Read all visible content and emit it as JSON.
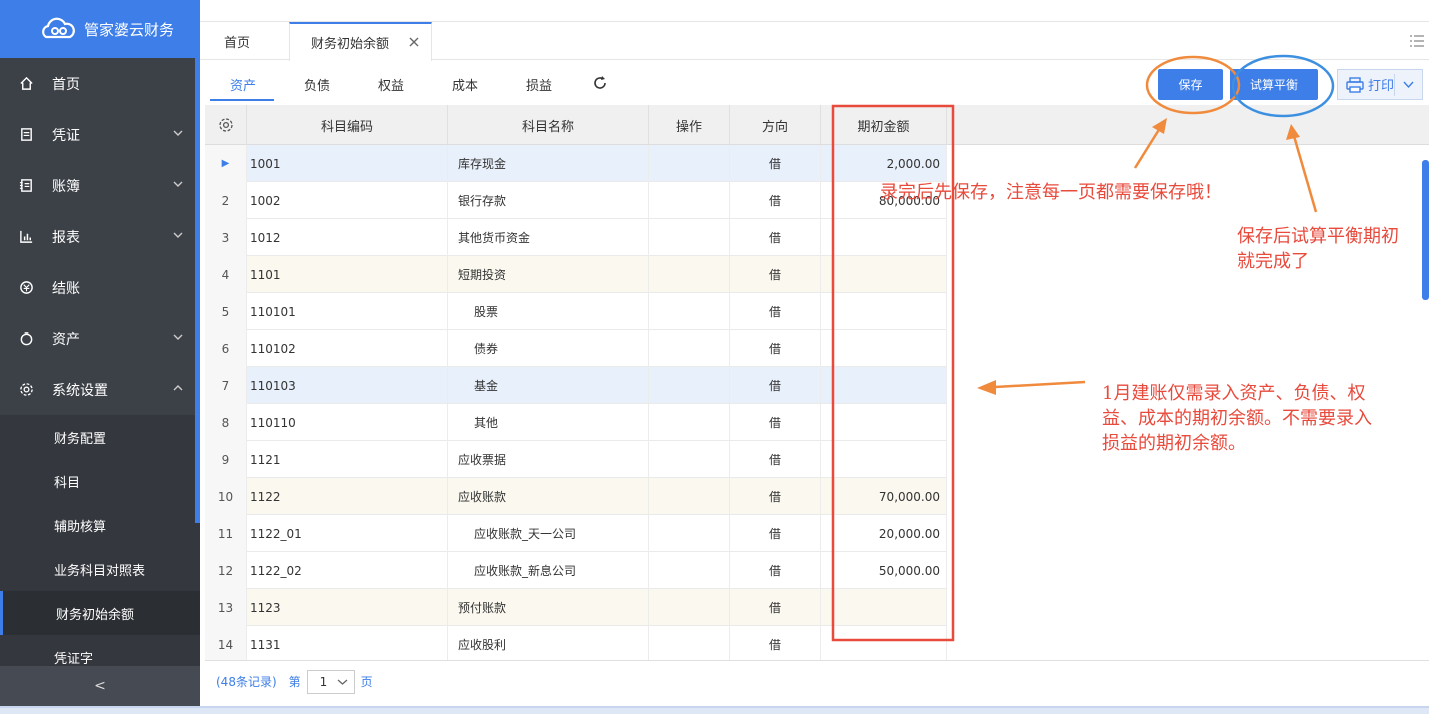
{
  "app": {
    "name": "管家婆云财务"
  },
  "sidebar": {
    "items": [
      {
        "label": "首页",
        "icon": "home-icon"
      },
      {
        "label": "凭证",
        "icon": "voucher-icon"
      },
      {
        "label": "账簿",
        "icon": "ledger-icon"
      },
      {
        "label": "报表",
        "icon": "chart-icon"
      },
      {
        "label": "结账",
        "icon": "close-period-icon"
      },
      {
        "label": "资产",
        "icon": "asset-icon"
      },
      {
        "label": "系统设置",
        "icon": "settings-icon"
      }
    ],
    "sub_items": [
      "财务配置",
      "科目",
      "辅助核算",
      "业务科目对照表",
      "财务初始余额",
      "凭证字"
    ],
    "active_sub": "财务初始余额",
    "collapse_label": "<"
  },
  "tabs": {
    "home": "首页",
    "active": "财务初始余额"
  },
  "subtabs": [
    "资产",
    "负债",
    "权益",
    "成本",
    "损益"
  ],
  "active_subtab": "资产",
  "toolbar": {
    "save": "保存",
    "balance": "试算平衡",
    "print": "打印"
  },
  "table": {
    "headers": [
      "科目编码",
      "科目名称",
      "操作",
      "方向",
      "期初金额"
    ],
    "rows": [
      {
        "no": "1",
        "code": "1001",
        "name": "库存现金",
        "dir": "借",
        "amount": "2,000.00"
      },
      {
        "no": "2",
        "code": "1002",
        "name": "银行存款",
        "dir": "借",
        "amount": "80,000.00"
      },
      {
        "no": "3",
        "code": "1012",
        "name": "其他货币资金",
        "dir": "借",
        "amount": ""
      },
      {
        "no": "4",
        "code": "1101",
        "name": "短期投资",
        "dir": "借",
        "amount": ""
      },
      {
        "no": "5",
        "code": "110101",
        "name": "股票",
        "dir": "借",
        "amount": ""
      },
      {
        "no": "6",
        "code": "110102",
        "name": "债券",
        "dir": "借",
        "amount": ""
      },
      {
        "no": "7",
        "code": "110103",
        "name": "基金",
        "dir": "借",
        "amount": ""
      },
      {
        "no": "8",
        "code": "110110",
        "name": "其他",
        "dir": "借",
        "amount": ""
      },
      {
        "no": "9",
        "code": "1121",
        "name": "应收票据",
        "dir": "借",
        "amount": ""
      },
      {
        "no": "10",
        "code": "1122",
        "name": "应收账款",
        "dir": "借",
        "amount": "70,000.00"
      },
      {
        "no": "11",
        "code": "1122_01",
        "name": "应收账款_天一公司",
        "dir": "借",
        "amount": "20,000.00"
      },
      {
        "no": "12",
        "code": "1122_02",
        "name": "应收账款_新息公司",
        "dir": "借",
        "amount": "50,000.00"
      },
      {
        "no": "13",
        "code": "1123",
        "name": "预付账款",
        "dir": "借",
        "amount": ""
      },
      {
        "no": "14",
        "code": "1131",
        "name": "应收股利",
        "dir": "借",
        "amount": ""
      }
    ]
  },
  "pager": {
    "records": "(48条记录)",
    "prefix": "第",
    "page": "1",
    "suffix": "页"
  },
  "annotations": {
    "save_note": "录完后先保存，注意每一页都需要保存哦！",
    "balance_note_1": "保存后试算平衡期初",
    "balance_note_2": "就完成了",
    "scope_note_1": "1月建账仅需录入资产、负债、权",
    "scope_note_2": "益、成本的期初余额。不需要录入",
    "scope_note_3": "损益的期初余额。"
  },
  "colors": {
    "brand": "#3d7ee8",
    "sidebar": "#3c4047",
    "annotation_red": "#e84a3c",
    "annotation_orange": "#f08a3c",
    "annotation_blue": "#3d8fe0"
  }
}
